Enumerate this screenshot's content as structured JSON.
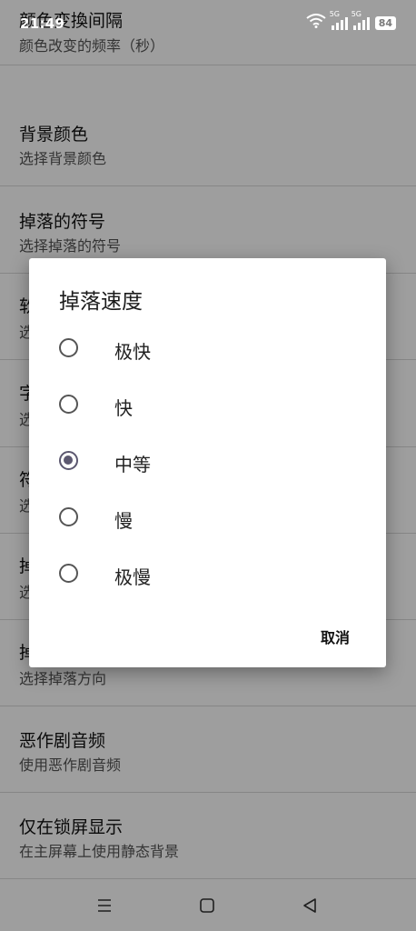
{
  "status_bar": {
    "time": "21:49",
    "signal_label_1": "5G",
    "signal_label_2": "5G",
    "battery": "84",
    "wifi_icon": "wifi-icon",
    "signal_icon": "signal-icon"
  },
  "settings": [
    {
      "title": "颜色变換间隔",
      "subtitle": "颜色改变的频率（秒）"
    },
    {
      "title": "背景颜色",
      "subtitle": "选择背景颜色"
    },
    {
      "title": "掉落的符号",
      "subtitle": "选择掉落的符号"
    },
    {
      "title": "软",
      "subtitle": "选"
    },
    {
      "title": "字",
      "subtitle": "选"
    },
    {
      "title": "符",
      "subtitle": "选"
    },
    {
      "title": "掉",
      "subtitle": "选"
    },
    {
      "title": "掉",
      "subtitle": "选择掉落方向"
    },
    {
      "title": "恶作剧音频",
      "subtitle": "使用恶作剧音频"
    },
    {
      "title": "仅在锁屏显示",
      "subtitle": "在主屏幕上使用静态背景"
    }
  ],
  "dialog": {
    "title": "掉落速度",
    "options": [
      "极快",
      "快",
      "中等",
      "慢",
      "极慢"
    ],
    "selected": "中等",
    "cancel_label": "取消"
  },
  "nav_bar": {
    "icons": [
      "menu-icon",
      "home-icon",
      "back-icon"
    ]
  },
  "colors": {
    "scrim": "#000000",
    "radio_accent": "#5c5870"
  }
}
